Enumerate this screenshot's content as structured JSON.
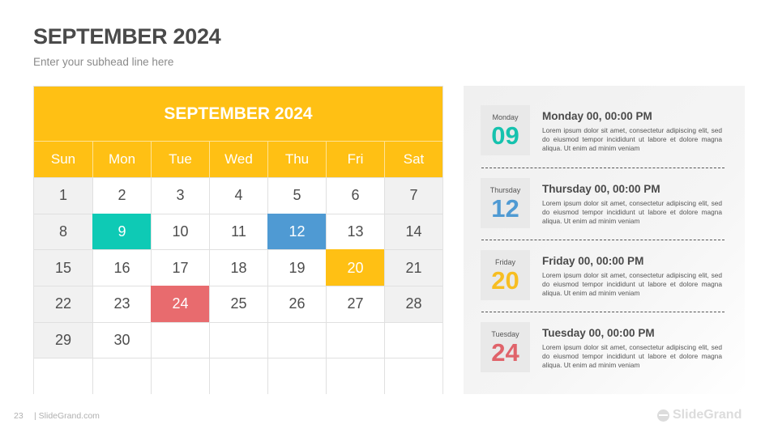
{
  "slide": {
    "title": "SEPTEMBER 2024",
    "subhead": "Enter your subhead line here",
    "page_number": "23",
    "site": "| SlideGrand.com",
    "brand": "SlideGrand"
  },
  "calendar": {
    "header": "SEPTEMBER 2024",
    "weekdays": [
      "Sun",
      "Mon",
      "Tue",
      "Wed",
      "Thu",
      "Fri",
      "Sat"
    ],
    "weeks": [
      [
        "1",
        "2",
        "3",
        "4",
        "5",
        "6",
        "7"
      ],
      [
        "8",
        "9",
        "10",
        "11",
        "12",
        "13",
        "14"
      ],
      [
        "15",
        "16",
        "17",
        "18",
        "19",
        "20",
        "21"
      ],
      [
        "22",
        "23",
        "24",
        "25",
        "26",
        "27",
        "28"
      ],
      [
        "29",
        "30",
        "",
        "",
        "",
        "",
        ""
      ],
      [
        "",
        "",
        "",
        "",
        "",
        "",
        ""
      ]
    ],
    "highlights": [
      {
        "day": "9",
        "color": "#0ECAB5"
      },
      {
        "day": "12",
        "color": "#4F9AD3"
      },
      {
        "day": "20",
        "color": "#FFC014"
      },
      {
        "day": "24",
        "color": "#E86B6E"
      }
    ],
    "colors": {
      "header": "#FFC014"
    }
  },
  "events": [
    {
      "weekday": "Monday",
      "day": "09",
      "color": "#16C2AE",
      "title": "Monday 00, 00:00 PM",
      "body": "Lorem ipsum dolor sit amet, consectetur adipiscing elit, sed do eiusmod tempor incididunt ut labore et dolore magna aliqua. Ut enim ad minim veniam"
    },
    {
      "weekday": "Thursday",
      "day": "12",
      "color": "#4F9AD3",
      "title": "Thursday 00, 00:00 PM",
      "body": "Lorem ipsum dolor sit amet, consectetur adipiscing elit, sed do eiusmod tempor incididunt ut labore et dolore magna aliqua. Ut enim ad minim veniam"
    },
    {
      "weekday": "Friday",
      "day": "20",
      "color": "#F7BE22",
      "title": "Friday 00, 00:00 PM",
      "body": "Lorem ipsum dolor sit amet, consectetur adipiscing elit, sed do eiusmod tempor incididunt ut labore et dolore magna aliqua. Ut enim ad minim veniam"
    },
    {
      "weekday": "Tuesday",
      "day": "24",
      "color": "#E0636A",
      "title": "Tuesday 00, 00:00 PM",
      "body": "Lorem ipsum dolor sit amet, consectetur adipiscing elit, sed do eiusmod tempor incididunt ut labore et dolore magna aliqua. Ut enim ad minim veniam"
    }
  ]
}
